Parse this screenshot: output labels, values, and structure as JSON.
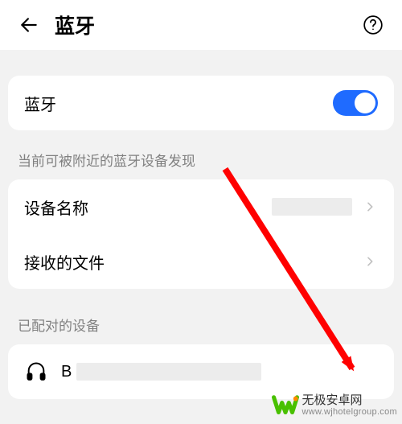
{
  "header": {
    "title": "蓝牙"
  },
  "bluetooth": {
    "label": "蓝牙",
    "on": true
  },
  "visibility_note": "当前可被附近的蓝牙设备发现",
  "device_name": {
    "label": "设备名称",
    "value_redacted": true
  },
  "received_files": {
    "label": "接收的文件"
  },
  "paired_section_label": "已配对的设备",
  "paired_device": {
    "leading_letter": "B",
    "name_redacted": true,
    "icon": "headphones-icon"
  },
  "watermark": {
    "brand": "无极安卓网",
    "url": "www.wjhotelgroup.com"
  },
  "colors": {
    "accent": "#1f6bff",
    "arrow": "#ff0000"
  }
}
